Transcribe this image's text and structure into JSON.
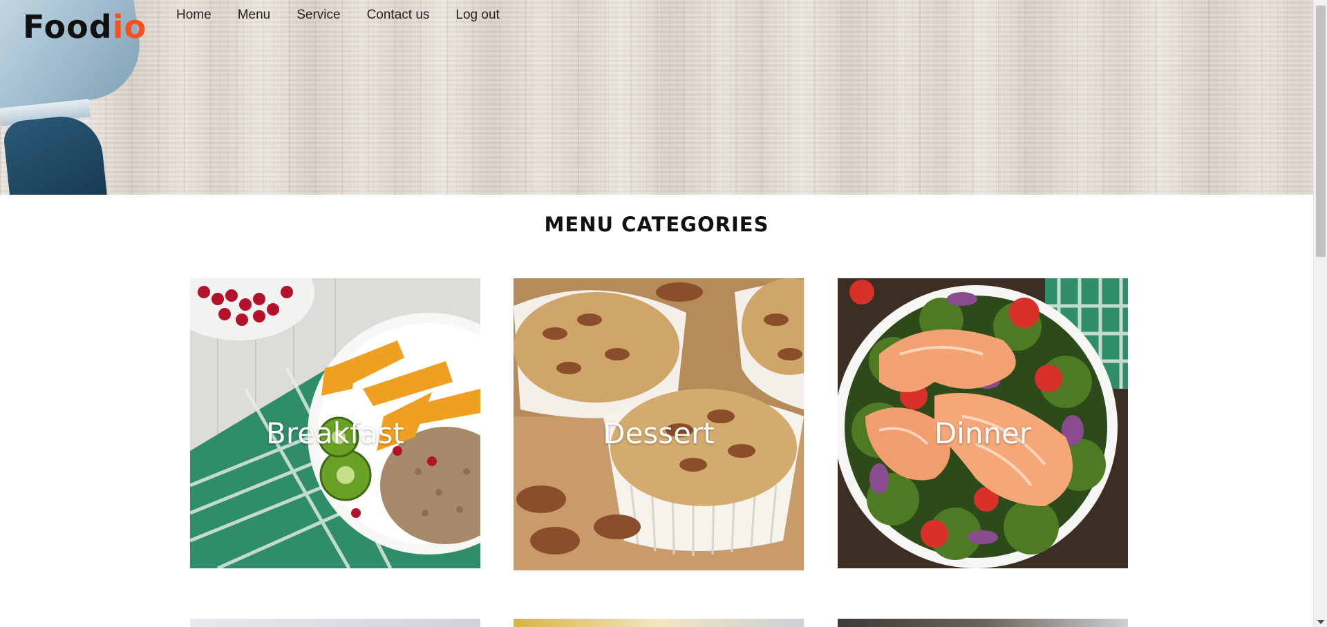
{
  "header": {
    "logo_main": "Food",
    "logo_accent": "io",
    "accent_color": "#f4511e",
    "nav": [
      {
        "label": "Home"
      },
      {
        "label": "Menu"
      },
      {
        "label": "Service"
      },
      {
        "label": "Contact us"
      },
      {
        "label": "Log out"
      }
    ]
  },
  "main": {
    "section_title": "MENU CATEGORIES",
    "categories": [
      {
        "label": "Breakfast",
        "image": "fruit-and-grain-bowl"
      },
      {
        "label": "Dessert",
        "image": "pecan-muffins"
      },
      {
        "label": "Dinner",
        "image": "salmon-with-broccoli"
      }
    ]
  }
}
